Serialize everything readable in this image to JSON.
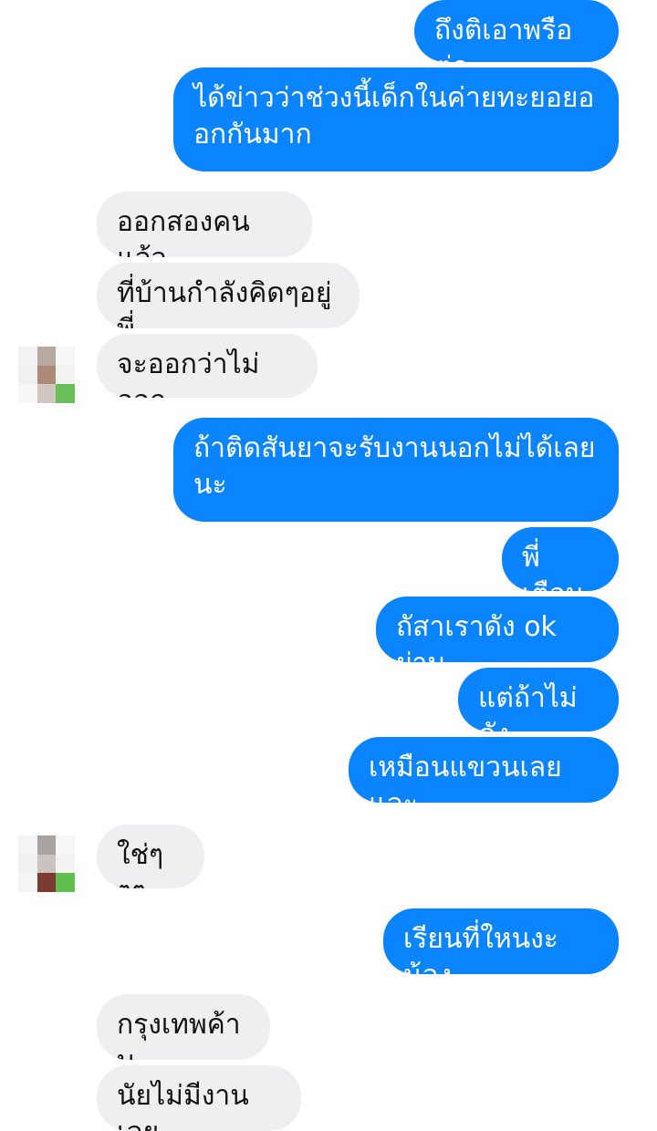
{
  "conversation": {
    "messages": [
      {
        "side": "out",
        "text": "ถึงติเอาพรือต่อ"
      },
      {
        "side": "out",
        "text": "ได้ข่าวว่าช่วงนี้เด็กในค่ายทะยอยอ\nอกกันมาก"
      },
      {
        "side": "in",
        "text": "ออกสองคนแล้ว"
      },
      {
        "side": "in",
        "text": "ที่บ้านกำลังคิดๆอยู่พี่"
      },
      {
        "side": "in",
        "text": "จะออกว่าไม่ออก"
      },
      {
        "side": "out",
        "text": "ถ้าติดสันยาจะรับงานนอกไม่ได้เลย\nนะ"
      },
      {
        "side": "out",
        "text": "พี่เตือน"
      },
      {
        "side": "out",
        "text": "ถัสาเราดัง ok ผ่าน"
      },
      {
        "side": "out",
        "text": "แต่ถ้าไม่ดัง"
      },
      {
        "side": "out",
        "text": "เหมือนแขวนเลยและ"
      },
      {
        "side": "in",
        "text": "ใช่ๆๆๆ"
      },
      {
        "side": "out",
        "text": "เรียนที่ใหนงะน้อง"
      },
      {
        "side": "in",
        "text": "กรุงเทพค้าบ"
      },
      {
        "side": "in",
        "text": "นัยไม่มีงานเลย"
      }
    ]
  },
  "colors": {
    "outgoing_bubble": "#0a84ff",
    "incoming_bubble": "#efeff1"
  },
  "avatars": [
    {
      "name": "contact-avatar-1",
      "pixelated": true
    },
    {
      "name": "contact-avatar-2",
      "pixelated": true
    }
  ]
}
